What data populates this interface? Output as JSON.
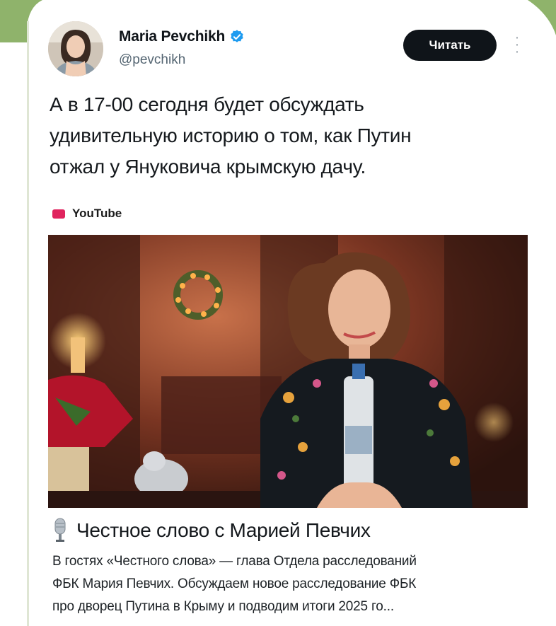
{
  "post": {
    "author_name": "Maria Pevchikh",
    "handle": "@pevchikh",
    "read_button": "Читать",
    "text_lines": [
      "А в 17-00 сегодня будет обсуждать",
      "удивительную историю о том, как Путин",
      "отжал у Януковича крымскую дачу."
    ]
  },
  "link_card": {
    "source": "YouTube",
    "title": "Честное слово с Марией Певчих",
    "description_lines": [
      "В гостях «Честного слова» — глава Отдела расследований",
      "ФБК Мария Певчих. Обсуждаем новое расследование ФБК",
      "про дворец Путина в Крыму и подводим итоги 2025 го..."
    ]
  },
  "colors": {
    "read_button_bg": "#0f1419",
    "verified_blue": "#1d9bf0",
    "youtube_red": "#e0245e"
  },
  "icons": [
    "verified-badge-icon",
    "more-options-icon",
    "youtube-icon",
    "microphone-icon"
  ]
}
